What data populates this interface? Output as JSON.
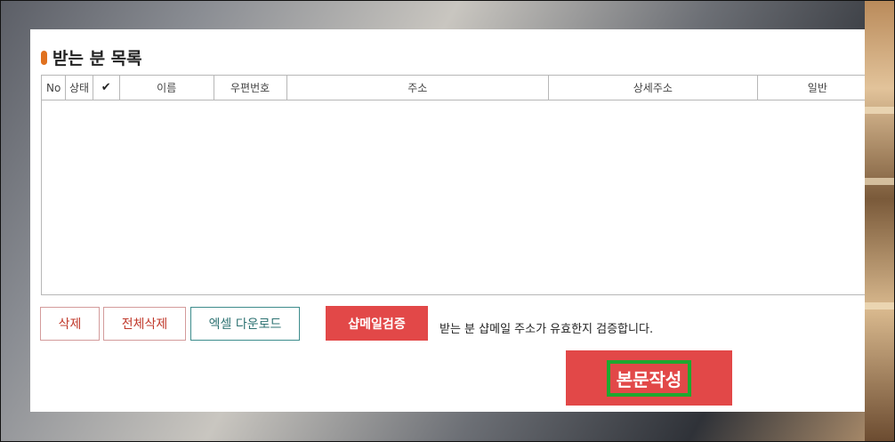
{
  "section": {
    "title": "받는 분 목록"
  },
  "table": {
    "headers": {
      "no": "No",
      "status": "상태",
      "check": "✔",
      "name": "이름",
      "zip": "우편번호",
      "address": "주소",
      "detail": "상세주소",
      "extra": "일반"
    },
    "rows": []
  },
  "buttons": {
    "delete": "삭제",
    "delete_all": "전체삭제",
    "excel": "엑셀 다운로드",
    "verify": "샵메일검증",
    "write": "본문작성"
  },
  "verify_note": "받는 분 샵메일 주소가 유효한지 검증합니다.",
  "colors": {
    "accent_red": "#e24848",
    "highlight_green": "#1fa82f",
    "title_dot": "#e0711f"
  }
}
